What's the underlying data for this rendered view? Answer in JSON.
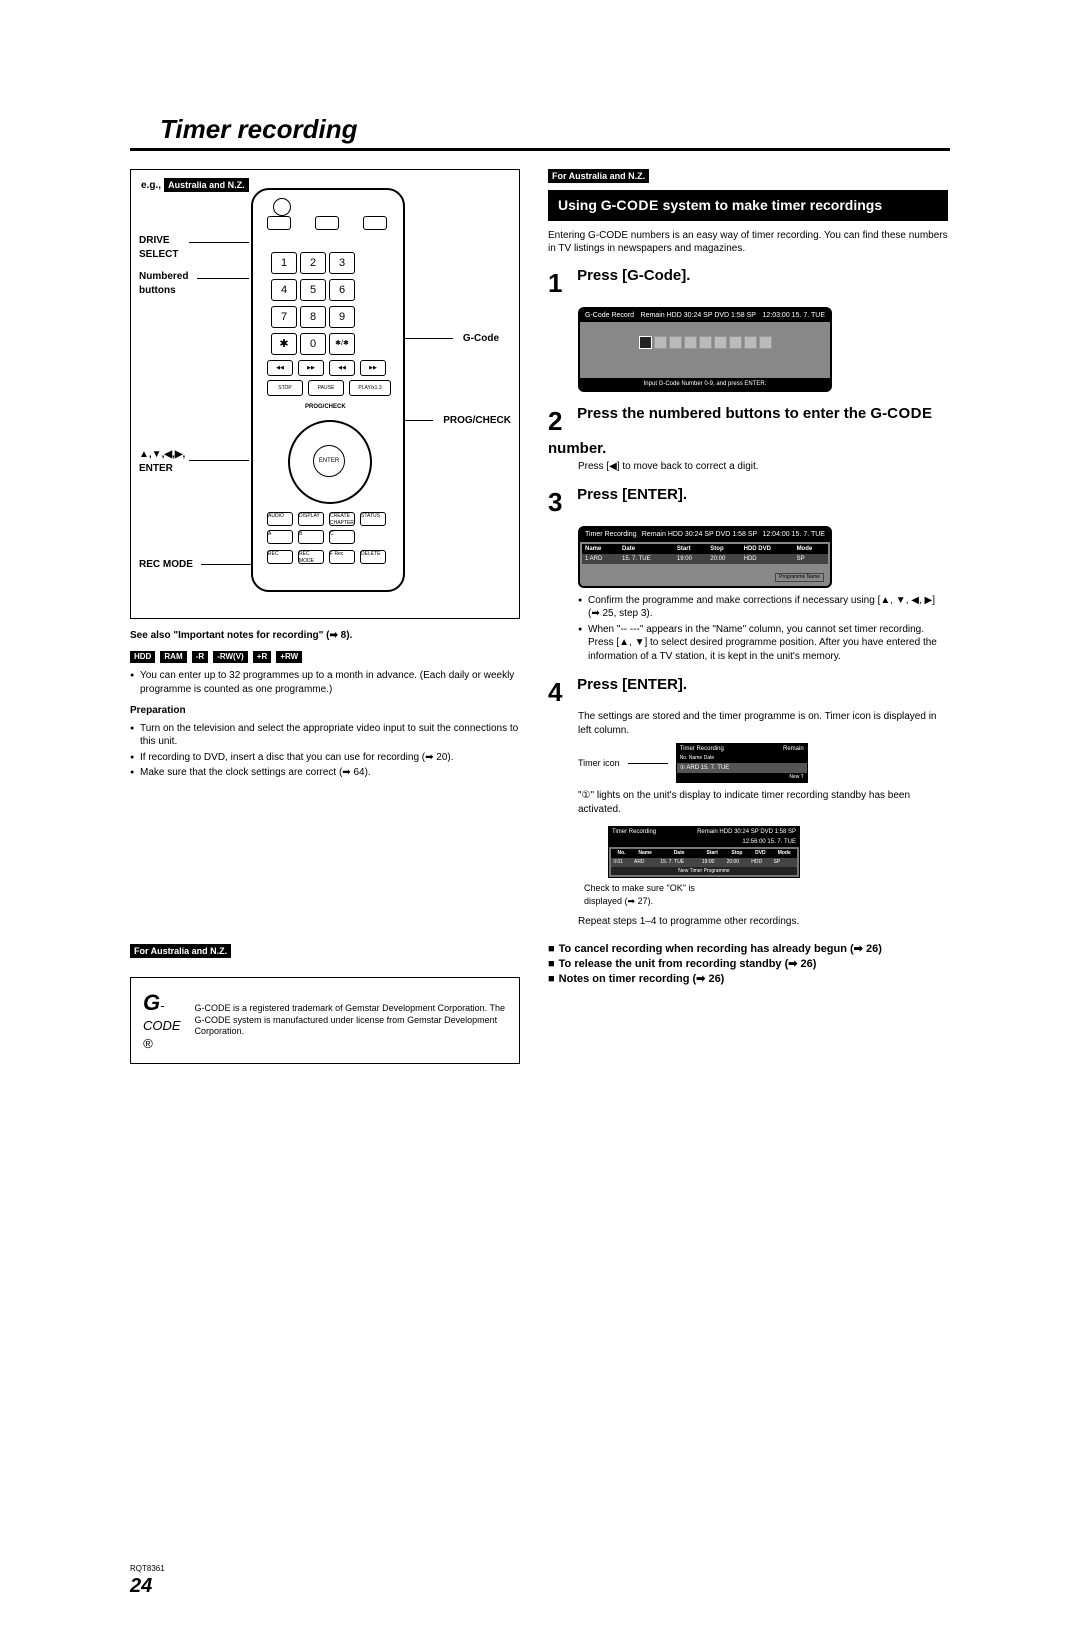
{
  "title": "Timer recording",
  "left": {
    "eg_prefix": "e.g.,",
    "eg_region": "Australia and N.Z.",
    "callouts": {
      "drive_select": "DRIVE SELECT",
      "numbered": "Numbered buttons",
      "gcode": "G-Code",
      "progcheck": "PROG/CHECK",
      "arrows_enter": "▲,▼,◀,▶, ENTER",
      "rec_mode": "REC MODE"
    },
    "remote": {
      "nums": [
        "1",
        "2",
        "3",
        "4",
        "5",
        "6",
        "7",
        "8",
        "9",
        "✱",
        "0",
        "✱/✱"
      ],
      "row_labels": [
        "◀◀",
        "▶▶",
        "◀◀",
        "▶▶"
      ],
      "stop": "STOP",
      "pause": "PAUSE",
      "play": "PLAY/x1.3",
      "prog": "PROG/CHECK",
      "enter": "ENTER",
      "bot": [
        "AUDIO",
        "DISPLAY",
        "CREATE CHAPTER",
        "STATUS",
        "A",
        "B",
        "C"
      ],
      "rec_row": [
        "REC",
        "REC MODE",
        "F Rec",
        "DELETE"
      ]
    },
    "see_also": "See also \"Important notes for recording\" (➡ 8).",
    "badges": [
      "HDD",
      "RAM",
      "-R",
      "-RW(V)",
      "+R",
      "+RW"
    ],
    "bullet1": "You can enter up to 32 programmes up to a month in advance. (Each daily or weekly programme is counted as one programme.)",
    "prep_head": "Preparation",
    "prep": [
      "Turn on the television and select the appropriate video input to suit the connections to this unit.",
      "If recording to DVD, insert a disc that you can use for recording (➡ 20).",
      "Make sure that the clock settings are correct (➡ 64)."
    ],
    "region2": "For Australia and N.Z.",
    "gcode_mark": "G",
    "gcode_suffix": "-CODE ®",
    "gcode_text": "G-CODE is a registered trademark of Gemstar Development Corporation. The G-CODE system is manufactured under license from Gemstar Development Corporation."
  },
  "right": {
    "region": "For Australia and N.Z.",
    "section_head_a": "Using G-",
    "section_head_b": "CODE",
    "section_head_c": " system to make timer recordings",
    "intro": "Entering G-CODE numbers is an easy way of timer recording. You can find these numbers in TV listings in newspapers and magazines.",
    "step1_title": "Press [G-Code].",
    "screen1": {
      "hdr_left": "G-Code Record",
      "hdr_mid": "Remain    HDD   30:24 SP    DVD   1:58 SP",
      "hdr_right": "12:03:00  15. 7. TUE",
      "foot": "Input G-Code  Number 0-9, and press ENTER."
    },
    "step2_title_a": "Press the numbered buttons to enter the G-",
    "step2_title_b": "CODE",
    "step2_title_c": " number.",
    "step2_note": "Press [◀] to move back to correct a digit.",
    "step3_title": "Press [ENTER].",
    "screen2": {
      "hdr_left": "Timer Recording",
      "hdr_mid": "Remain    HDD   30:24 SP    DVD   1:58 SP",
      "hdr_right": "12:04:00  15. 7. TUE",
      "cols": [
        "Name",
        "Date",
        "Start",
        "Stop",
        "HDD DVD",
        "Mode"
      ],
      "row": [
        "1  ARD",
        "15. 7. TUE",
        "19:00",
        "20:00",
        "HDD",
        "SP"
      ],
      "prog_name": "Programme Name"
    },
    "step3_bullets": [
      "Confirm the programme and make corrections if necessary using [▲, ▼, ◀, ▶] (➡ 25, step 3).",
      "When \"-- ---\" appears in the \"Name\" column, you cannot set timer recording. Press [▲, ▼] to select desired programme position. After you have entered the information of a TV station, it is kept in the unit's memory."
    ],
    "step4_title": "Press [ENTER].",
    "step4_text": "The settings are stored and the timer programme is on. Timer icon is displayed in left column.",
    "timer_icon_label": "Timer icon",
    "mini": {
      "hdr_l": "Timer Recording",
      "hdr_r": "Remain",
      "cols": "No.   Name      Date",
      "row": "①    ARD      15. 7. TUE",
      "row2": "New T"
    },
    "step4_note": "\"①\" lights on the unit's display to indicate timer recording standby has been activated.",
    "screen3": {
      "hdr_l": "Timer Recording",
      "hdr_mid": "Remain   HDD  30:24 SP   DVD  1:58 SP",
      "hdr_r": "12:56:00  15. 7. TUE",
      "cols": [
        "No.",
        "Name",
        "Date",
        "Start",
        "Stop",
        "DVD",
        "Mode"
      ],
      "row": [
        "①01",
        "ARD",
        "15. 7. TUE",
        "19:00",
        "20:00",
        "HDD",
        "SP"
      ],
      "foot": "New Timer Programme"
    },
    "check_note": "Check to make sure \"OK\" is displayed (➡ 27).",
    "repeat": "Repeat steps 1–4 to programme other recordings.",
    "extras": [
      "To cancel recording when recording has already begun (➡ 26)",
      "To release the unit from recording standby (➡ 26)",
      "Notes on timer recording (➡ 26)"
    ]
  },
  "footer": {
    "model": "RQT8361",
    "page": "24"
  }
}
